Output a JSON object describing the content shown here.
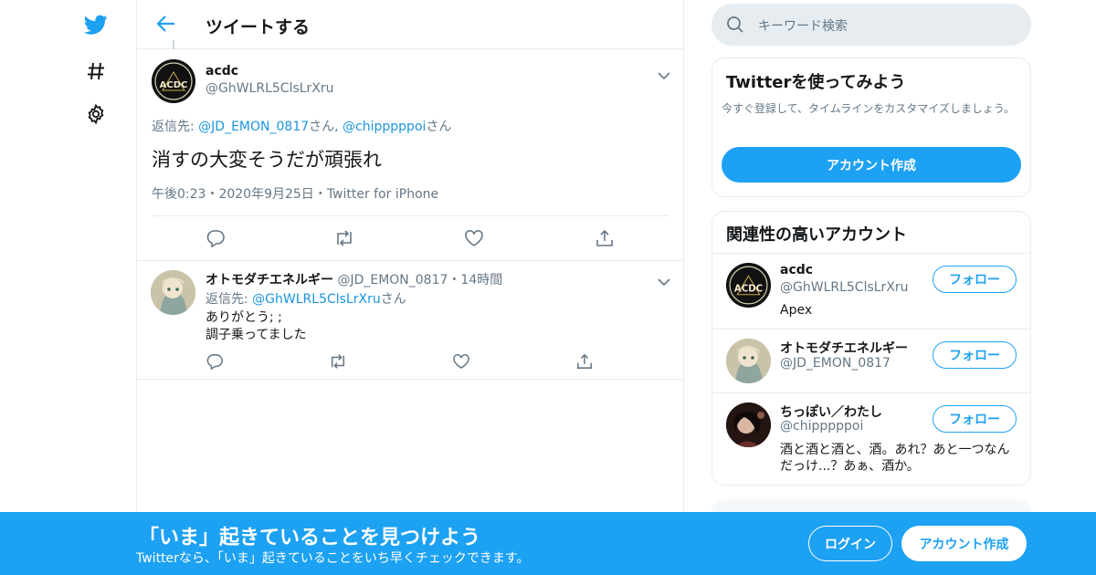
{
  "colors": {
    "accent": "#1da1f2",
    "text": "#14171a",
    "muted": "#657786",
    "border": "#e6ecf0"
  },
  "nav": {
    "icons": [
      "twitter-bird-icon",
      "hashtag-icon",
      "settings-gear-icon"
    ]
  },
  "header": {
    "title": "ツイートする"
  },
  "tweet": {
    "name": "acdc",
    "handle": "@GhWLRL5ClsLrXru",
    "reply_prefix": "返信先: ",
    "reply_user1": "@JD_EMON_0817",
    "reply_san1": "さん",
    "reply_comma": ", ",
    "reply_user2": "@chipppppoi",
    "reply_san2": "さん",
    "text": "消すの大変そうだが頑張れ",
    "time": "午後0:23",
    "dot": "・",
    "date": "2020年9月25日",
    "client": "Twitter for iPhone"
  },
  "reply": {
    "name": "オトモダチエネルギー",
    "handle": "@JD_EMON_0817",
    "dot": "・",
    "age": "14時間",
    "reply_prefix": "返信先: ",
    "reply_user": "@GhWLRL5ClsLrXru",
    "reply_san": "さん",
    "line1": "ありがとう; ;",
    "line2": "調子乗ってました"
  },
  "sidebar": {
    "search_placeholder": "キーワード検索",
    "signup_card": {
      "title": "Twitterを使ってみよう",
      "desc": "今すぐ登録して、タイムラインをカスタマイズしましょう。",
      "button": "アカウント作成"
    },
    "related": {
      "title": "関連性の高いアカウント",
      "follow_label": "フォロー",
      "accounts": [
        {
          "name": "acdc",
          "handle": "@GhWLRL5ClsLrXru",
          "bio": "Apex"
        },
        {
          "name": "オトモダチエネルギー",
          "handle": "@JD_EMON_0817",
          "bio": ""
        },
        {
          "name": "ちっぽい／わたし",
          "handle": "@chipppppoi",
          "bio": "酒と酒と酒と、酒。あれ？あと一つなんだっけ...？あぁ、酒か。"
        }
      ]
    }
  },
  "banner": {
    "title": "「いま」起きていることを見つけよう",
    "subtitle": "Twitterなら、「いま」起きていることをいち早くチェックできます。",
    "login": "ログイン",
    "signup": "アカウント作成"
  }
}
